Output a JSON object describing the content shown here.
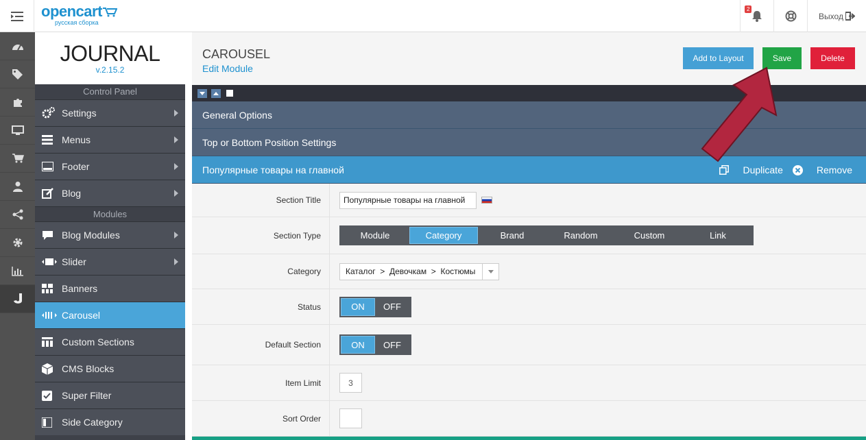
{
  "topbar": {
    "logo": {
      "brand": "opencart",
      "sub": "русская сборка"
    },
    "notifications": {
      "count": "2"
    },
    "logout_label": "Выход"
  },
  "journal": {
    "title": "JOURNAL",
    "version": "v.2.15.2",
    "section_control": "Control Panel",
    "section_modules": "Modules",
    "control_items": [
      {
        "label": "Settings",
        "icon": "gears-icon"
      },
      {
        "label": "Menus",
        "icon": "bars-icon"
      },
      {
        "label": "Footer",
        "icon": "footer-icon"
      },
      {
        "label": "Blog",
        "icon": "edit-icon"
      }
    ],
    "module_items": [
      {
        "label": "Blog Modules",
        "icon": "comment-icon"
      },
      {
        "label": "Slider",
        "icon": "slider-icon"
      },
      {
        "label": "Banners",
        "icon": "grid-icon"
      },
      {
        "label": "Carousel",
        "icon": "carousel-icon"
      },
      {
        "label": "Custom Sections",
        "icon": "sections-icon"
      },
      {
        "label": "CMS Blocks",
        "icon": "cube-icon"
      },
      {
        "label": "Super Filter",
        "icon": "checkbox-icon"
      },
      {
        "label": "Side Category",
        "icon": "sidecat-icon"
      }
    ]
  },
  "header": {
    "title": "CAROUSEL",
    "subtitle": "Edit Module",
    "add_layout": "Add to Layout",
    "save": "Save",
    "delete": "Delete"
  },
  "panels": {
    "general": "General Options",
    "position": "Top or Bottom Position Settings",
    "section": "Популярные товары на главной",
    "duplicate": "Duplicate",
    "remove": "Remove"
  },
  "form": {
    "section_title": {
      "label": "Section Title",
      "value": "Популярные товары на главной"
    },
    "section_type": {
      "label": "Section Type",
      "options": [
        "Module",
        "Category",
        "Brand",
        "Random",
        "Custom",
        "Link"
      ],
      "selected": "Category"
    },
    "category": {
      "label": "Category",
      "value": "Каталог  >  Девочкам  >  Костюмы"
    },
    "status": {
      "label": "Status",
      "on": "ON",
      "off": "OFF"
    },
    "default_section": {
      "label": "Default Section",
      "on": "ON",
      "off": "OFF"
    },
    "item_limit": {
      "label": "Item Limit",
      "value": "3"
    },
    "sort_order": {
      "label": "Sort Order",
      "value": ""
    }
  },
  "colors": {
    "accent": "#4aa5d9",
    "save": "#21a446",
    "delete": "#e0203a"
  }
}
